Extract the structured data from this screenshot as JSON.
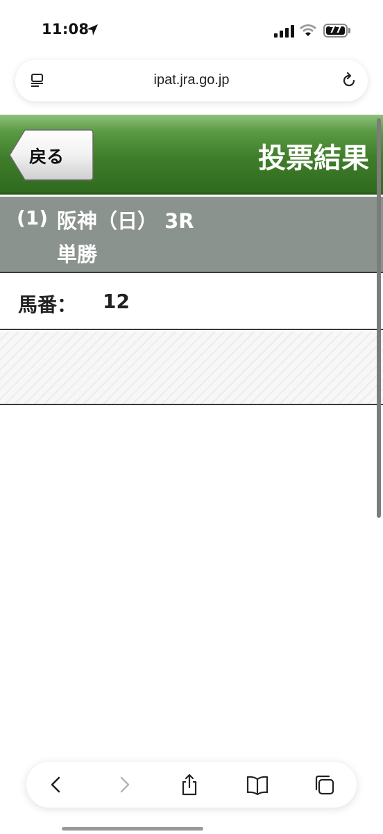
{
  "status_bar": {
    "time": "11:08",
    "battery": "77"
  },
  "browser": {
    "url": "ipat.jra.go.jp"
  },
  "header": {
    "back_label": "戻る",
    "title": "投票結果",
    "accent": "#3f7d2a"
  },
  "race": {
    "number": "(1)",
    "name": "阪神（日） 3R",
    "bet_type": "単勝"
  },
  "horse": {
    "label": "馬番：",
    "value": "12"
  },
  "toolbar": {
    "icons": [
      "back-icon",
      "forward-icon",
      "share-icon",
      "bookmarks-icon",
      "tabs-icon"
    ]
  }
}
